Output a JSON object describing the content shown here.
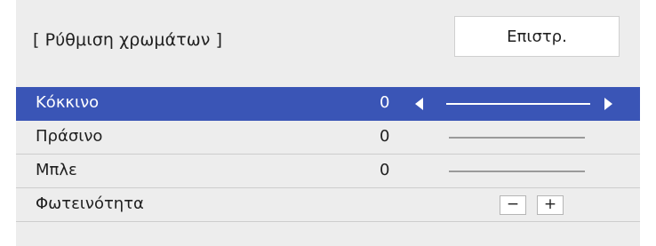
{
  "dialog": {
    "title": "[ Ρύθμιση χρωμάτων ]",
    "back_label": "Επιστρ."
  },
  "rows": [
    {
      "label": "Κόκκινο",
      "value": "0",
      "selected": true,
      "control": "slider"
    },
    {
      "label": "Πράσινο",
      "value": "0",
      "selected": false,
      "control": "slider"
    },
    {
      "label": "Μπλε",
      "value": "0",
      "selected": false,
      "control": "slider"
    },
    {
      "label": "Φωτεινότητα",
      "selected": false,
      "control": "stepper",
      "minus_label": "−",
      "plus_label": "+"
    }
  ],
  "colors": {
    "panel_bg": "#ededed",
    "selected_row_bg": "#3a55b6",
    "text": "#1f1f1f"
  }
}
